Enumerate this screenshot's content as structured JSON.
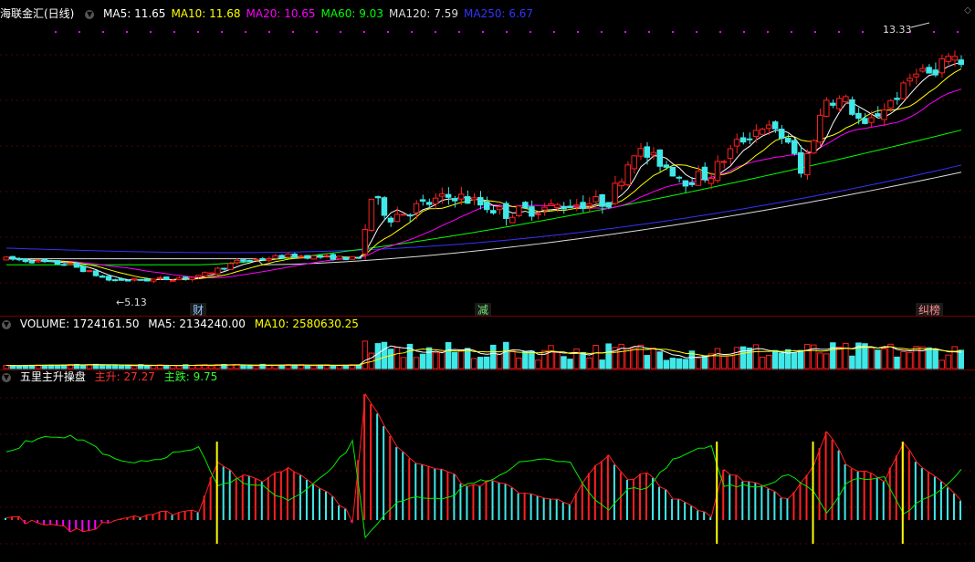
{
  "main": {
    "stock": "海联金汇(日线)",
    "ma": [
      {
        "label": "MA5: 11.65",
        "color": "#ffffff"
      },
      {
        "label": "MA10: 11.68",
        "color": "#ffff00"
      },
      {
        "label": "MA20: 10.65",
        "color": "#ff00ff"
      },
      {
        "label": "MA60: 9.03",
        "color": "#00ff00"
      },
      {
        "label": "MA120: 7.59",
        "color": "#dddddd"
      },
      {
        "label": "MA250: 6.67",
        "color": "#3333ff"
      }
    ],
    "high_label": "13.33",
    "low_label": "5.13",
    "markers": [
      {
        "label": "财",
        "color": "#8ec8ff"
      },
      {
        "label": "减",
        "color": "#6fe86f"
      },
      {
        "label": "纠榜",
        "color": "#ff8a8a"
      }
    ]
  },
  "volume": {
    "title": "VOLUME: 1724161.50",
    "ma5": "MA5: 2134240.00",
    "ma10": "MA10: 2580630.25"
  },
  "indicator": {
    "name": "五里主升操盘",
    "up": "主升: 27.27",
    "down": "主跌: 9.75"
  },
  "colors": {
    "up": "#ff2020",
    "down": "#40e8e8",
    "bg": "#000000",
    "grid": "#7a0000"
  }
}
